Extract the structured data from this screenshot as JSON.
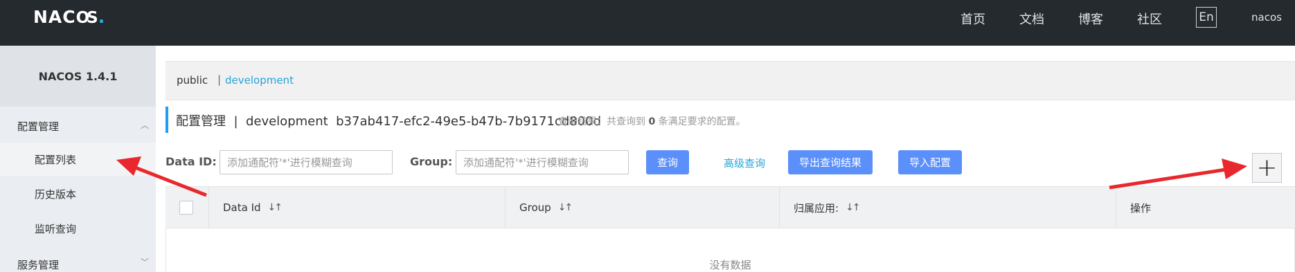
{
  "brand": {
    "logo_main": "NAC",
    "logo_oo": "OS",
    "logo_dot": "."
  },
  "topnav": {
    "items": [
      "首页",
      "文档",
      "博客",
      "社区"
    ],
    "lang": "En",
    "user": "nacos"
  },
  "sidebar": {
    "version": "NACOS 1.4.1",
    "group1": "配置管理",
    "items": [
      "配置列表",
      "历史版本",
      "监听查询"
    ],
    "group2": "服务管理"
  },
  "namespaces": {
    "public": "public",
    "separator": "|",
    "current": "development"
  },
  "header": {
    "title": "配置管理  |  development  b37ab417-efc2-49e5-b47b-7b9171cd800d",
    "result_prefix": "查询结果：共查询到 ",
    "result_count": "0",
    "result_suffix": " 条满足要求的配置。"
  },
  "filters": {
    "dataid_label": "Data ID:",
    "dataid_placeholder": "添加通配符'*'进行模糊查询",
    "group_label": "Group:",
    "group_placeholder": "添加通配符'*'进行模糊查询",
    "query_btn": "查询",
    "advanced_link": "高级查询",
    "export_btn": "导出查询结果",
    "import_btn": "导入配置",
    "add_btn": "+"
  },
  "table": {
    "columns": [
      "Data Id",
      "Group",
      "归属应用:",
      "操作"
    ],
    "sort_icon": "↓↑",
    "empty_text": "没有数据"
  },
  "colors": {
    "accent": "#5b8ff9",
    "link": "#25a3d8",
    "annotation": "#e8282d",
    "topbar": "#252a2f"
  }
}
